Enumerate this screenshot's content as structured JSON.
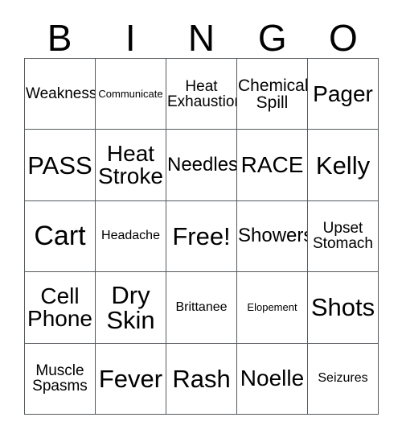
{
  "card": {
    "type": "bingo-card",
    "columns": 5,
    "rows": 5,
    "header": [
      "B",
      "I",
      "N",
      "G",
      "O"
    ],
    "colors": {
      "background": "#ffffff",
      "text": "#000000",
      "border": "#555a5e"
    },
    "cells": [
      [
        {
          "text": "Weakness",
          "size": "md"
        },
        {
          "text": "Communicate",
          "size": "xs"
        },
        {
          "text": "Heat\nExhaustion",
          "size": "md"
        },
        {
          "text": "Chemical\nSpill",
          "size": "lg"
        },
        {
          "text": "Pager",
          "size": "2xl"
        }
      ],
      [
        {
          "text": "PASS",
          "size": "3xl"
        },
        {
          "text": "Heat\nStroke",
          "size": "2xl"
        },
        {
          "text": "Needles",
          "size": "xl"
        },
        {
          "text": "RACE",
          "size": "2xl"
        },
        {
          "text": "Kelly",
          "size": "3xl"
        }
      ],
      [
        {
          "text": "Cart",
          "size": "4xl"
        },
        {
          "text": "Headache",
          "size": "sm"
        },
        {
          "text": "Free!",
          "size": "3xl"
        },
        {
          "text": "Showers",
          "size": "xl"
        },
        {
          "text": "Upset\nStomach",
          "size": "md"
        }
      ],
      [
        {
          "text": "Cell\nPhone",
          "size": "2xl"
        },
        {
          "text": "Dry\nSkin",
          "size": "3xl"
        },
        {
          "text": "Brittanee",
          "size": "sm"
        },
        {
          "text": "Elopement",
          "size": "xs"
        },
        {
          "text": "Shots",
          "size": "3xl"
        }
      ],
      [
        {
          "text": "Muscle\nSpasms",
          "size": "md"
        },
        {
          "text": "Fever",
          "size": "3xl"
        },
        {
          "text": "Rash",
          "size": "3xl"
        },
        {
          "text": "Noelle",
          "size": "2xl"
        },
        {
          "text": "Seizures",
          "size": "sm"
        }
      ]
    ]
  }
}
